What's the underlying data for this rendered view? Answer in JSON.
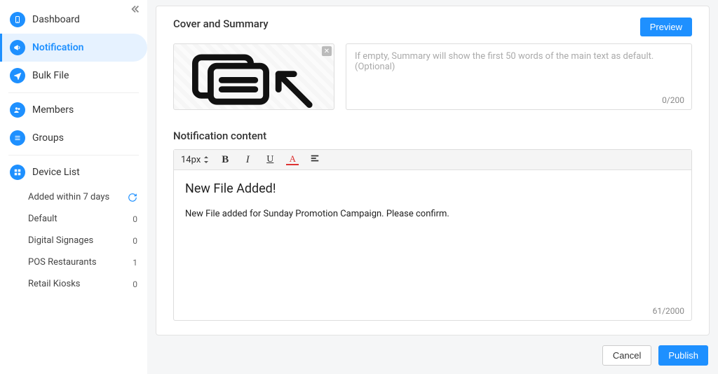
{
  "sidebar": {
    "items": [
      {
        "label": "Dashboard"
      },
      {
        "label": "Notification"
      },
      {
        "label": "Bulk File"
      },
      {
        "label": "Members"
      },
      {
        "label": "Groups"
      },
      {
        "label": "Device List"
      }
    ],
    "device_sub": [
      {
        "label": "Added within 7 days",
        "count": ""
      },
      {
        "label": "Default",
        "count": "0"
      },
      {
        "label": "Digital Signages",
        "count": "0"
      },
      {
        "label": "POS Restaurants",
        "count": "1"
      },
      {
        "label": "Retail Kiosks",
        "count": "0"
      }
    ]
  },
  "cover_section": {
    "title": "Cover and Summary",
    "preview_label": "Preview",
    "summary_placeholder": "If empty, Summary will show the first 50 words of the main text as default. (Optional)",
    "summary_counter": "0/200"
  },
  "content_section": {
    "title": "Notification content",
    "toolbar": {
      "font_size": "14px"
    },
    "heading": "New File Added!",
    "body": "New File added for Sunday Promotion Campaign. Please confirm.",
    "counter": "61/2000"
  },
  "footer": {
    "cancel": "Cancel",
    "publish": "Publish"
  }
}
